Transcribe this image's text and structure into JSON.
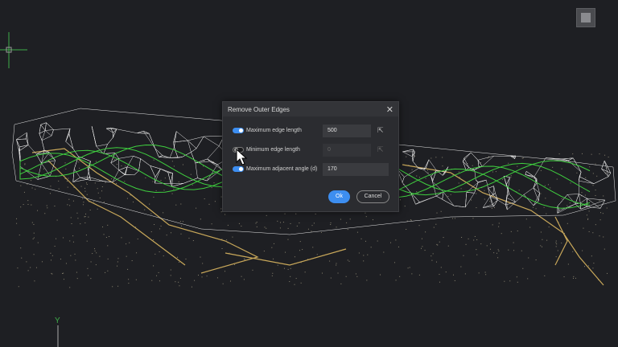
{
  "dialog": {
    "title": "Remove Outer Edges",
    "close_icon": "close-icon",
    "rows": [
      {
        "label": "Maximum edge length",
        "enabled": true,
        "value": "500",
        "picker": true
      },
      {
        "label": "Minimum edge length",
        "enabled": false,
        "value": "0",
        "picker": true
      },
      {
        "label": "Maximum adjacent angle (d)",
        "enabled": true,
        "value": "170",
        "picker": false
      }
    ],
    "ok_label": "Ok",
    "cancel_label": "Cancel"
  },
  "viewport": {
    "axis_label": "Y",
    "colors": {
      "background": "#1e1f23",
      "mesh": "#ffffff",
      "contour": "#3fcf3f",
      "breakline": "#c9a85a",
      "accent": "#3d8ef0"
    }
  }
}
